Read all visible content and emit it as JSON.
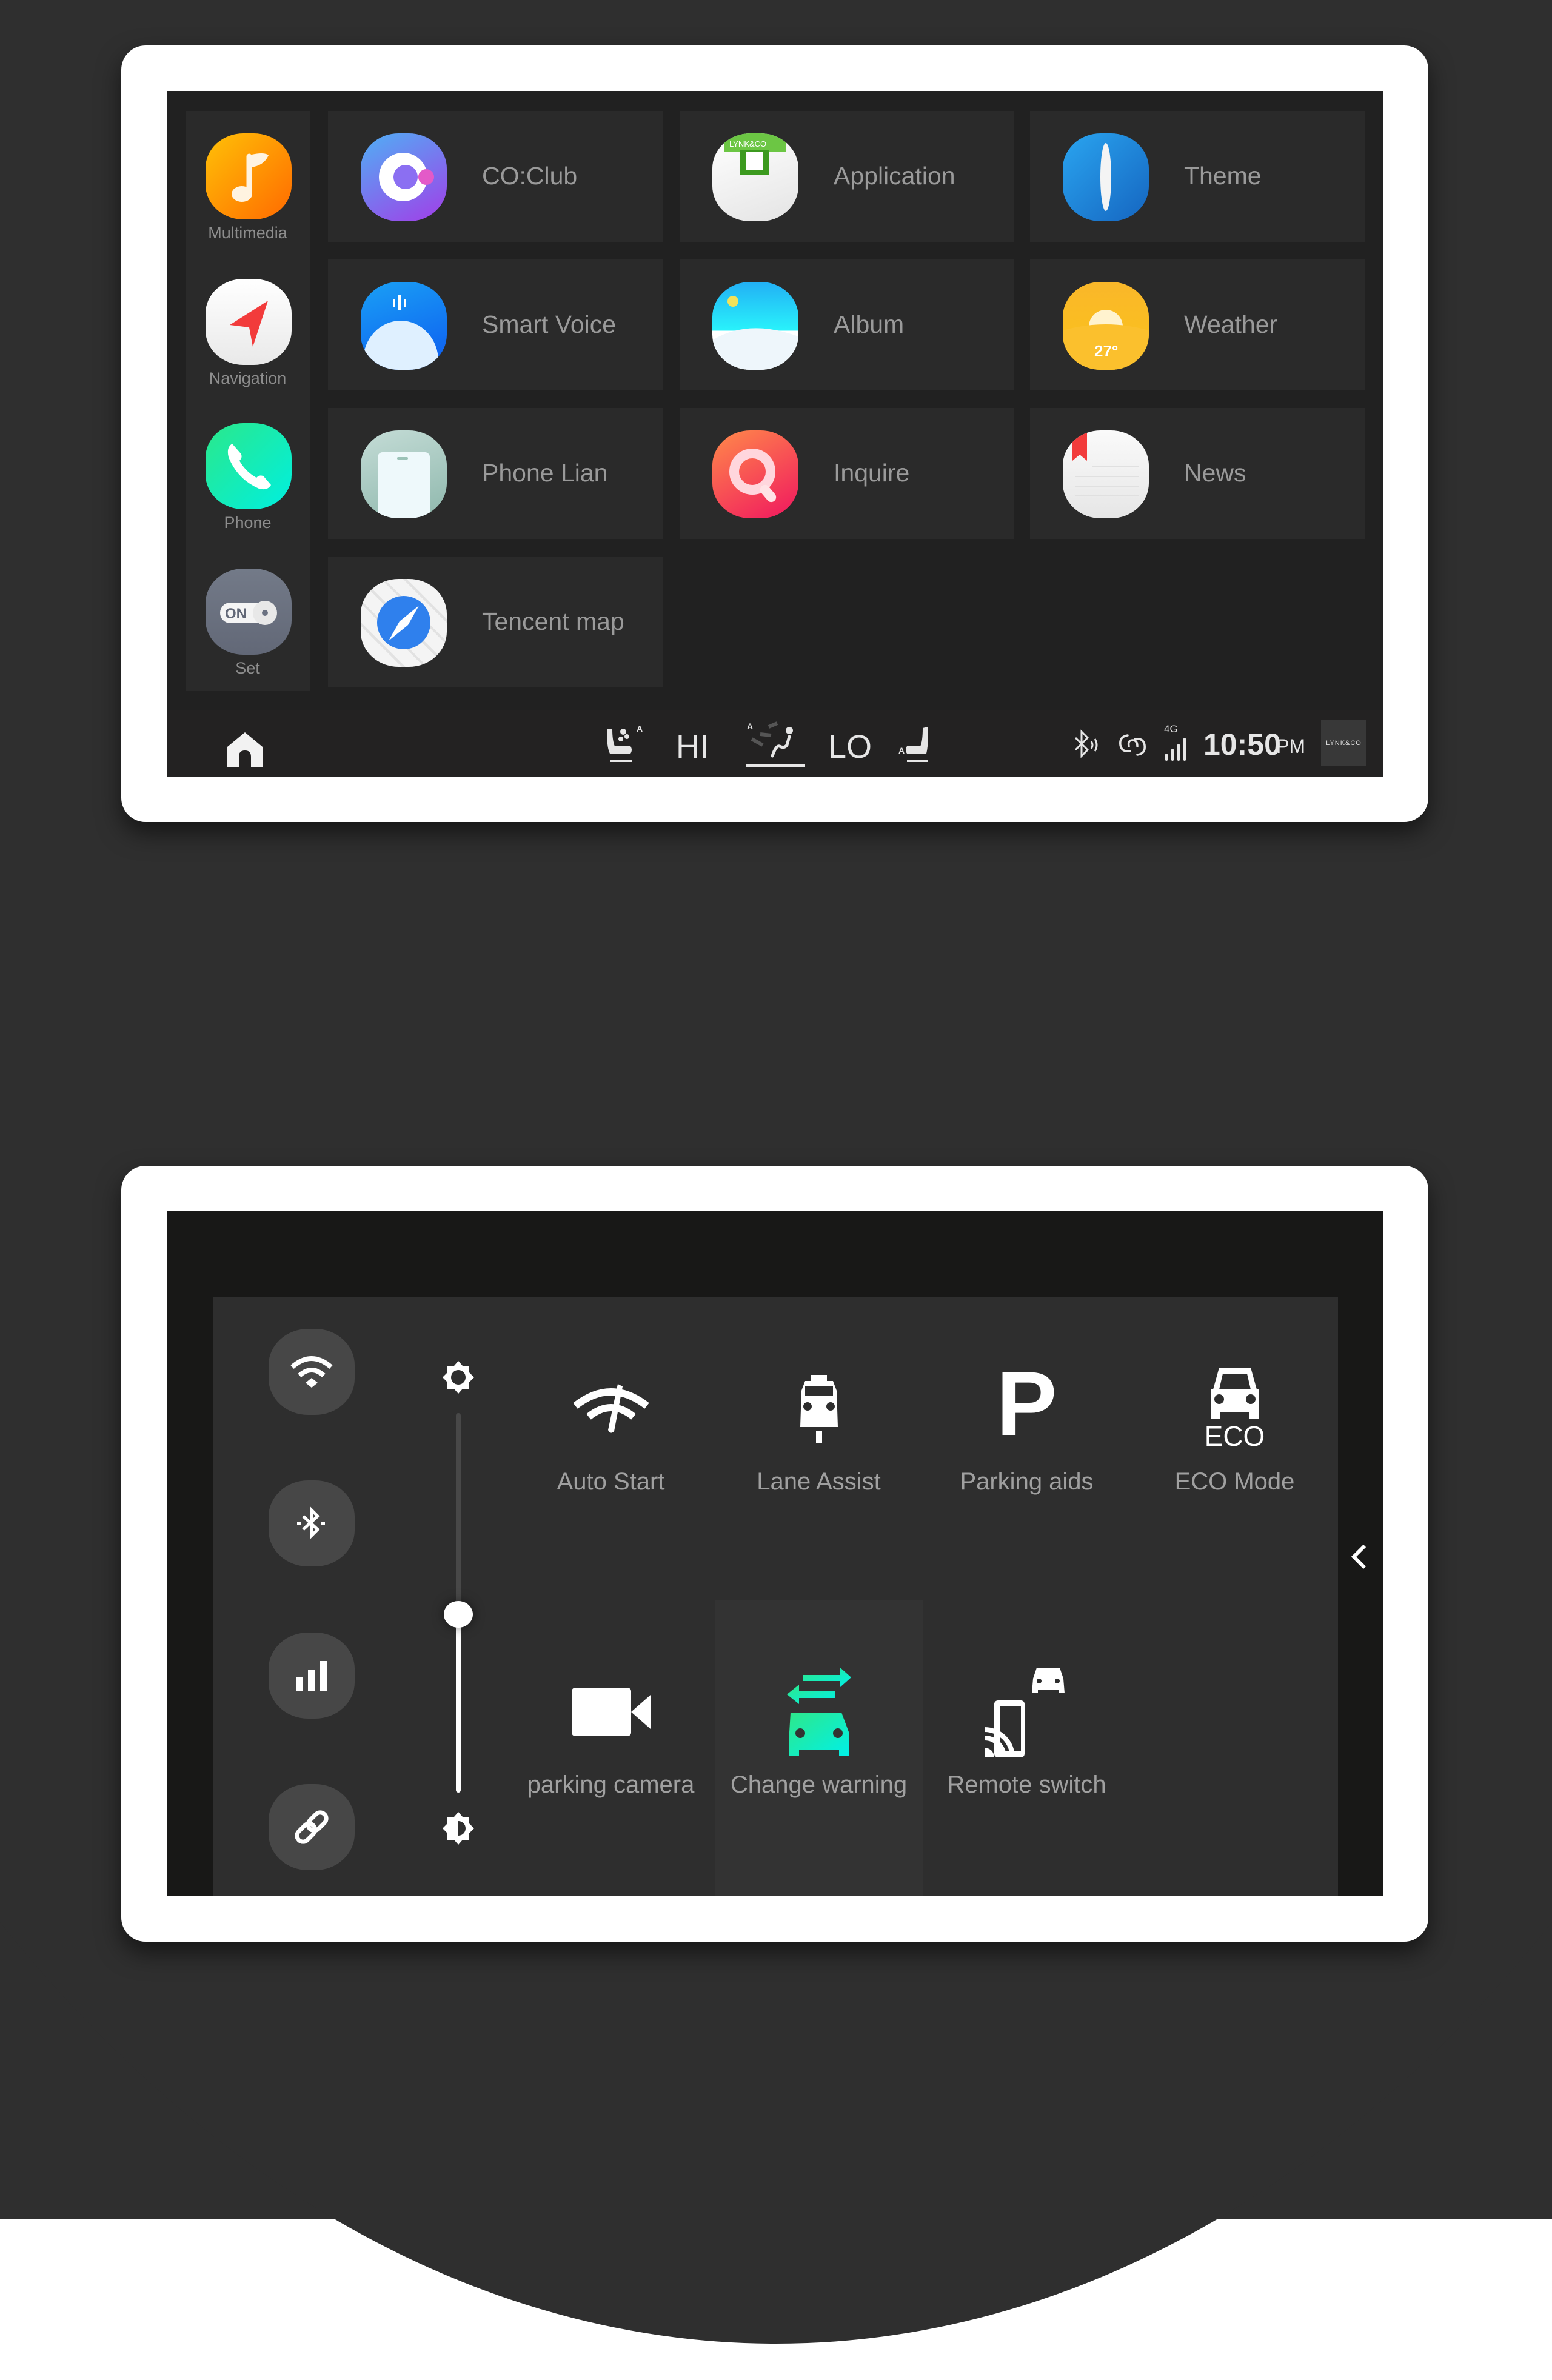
{
  "home_screen": {
    "sidebar": [
      {
        "label": "Multimedia",
        "icon": "music-note-icon",
        "color": "#ff8a00"
      },
      {
        "label": "Navigation",
        "icon": "navigation-arrow-icon",
        "color": "#f2f2f2"
      },
      {
        "label": "Phone",
        "icon": "phone-icon",
        "color": "#1de9b6"
      },
      {
        "label": "Set",
        "icon": "settings-toggle-icon",
        "color": "#6b7282"
      }
    ],
    "apps": [
      {
        "label": "CO:Club",
        "icon": "coclub-icon",
        "color": "#7b6cf0"
      },
      {
        "label": "Application",
        "icon": "application-store-icon",
        "color": "#5aa92d"
      },
      {
        "label": "Theme",
        "icon": "theme-icon",
        "color": "#1e88e5"
      },
      {
        "label": "Smart Voice",
        "icon": "smart-voice-icon",
        "color": "#1a73e8"
      },
      {
        "label": "Album",
        "icon": "album-icon",
        "color": "#29d3f6"
      },
      {
        "label": "Weather",
        "icon": "weather-icon",
        "color": "#f8b21a",
        "badge": "27°"
      },
      {
        "label": "Phone Lian",
        "icon": "phone-link-icon",
        "color": "#9cc3b8"
      },
      {
        "label": "Inquire",
        "icon": "inquire-search-icon",
        "color": "#f0356a"
      },
      {
        "label": "News",
        "icon": "news-icon",
        "color": "#f3f3f3"
      },
      {
        "label": "Tencent map",
        "icon": "tencent-map-icon",
        "color": "#2f80ed"
      }
    ],
    "status_bar": {
      "fan_level": "HI",
      "temp_level": "LO",
      "seat_auto_label": "A",
      "network": "4G",
      "time": "10:50",
      "ampm": "PM",
      "brand": "LYNK&CO"
    }
  },
  "control_center": {
    "brightness_level": 0.47,
    "quick_toggles": [
      {
        "name": "wifi",
        "icon": "wifi-icon"
      },
      {
        "name": "bluetooth",
        "icon": "bluetooth-icon"
      },
      {
        "name": "cellular",
        "icon": "signal-bars-icon"
      },
      {
        "name": "link",
        "icon": "link-icon"
      }
    ],
    "features": [
      {
        "label": "Auto Start",
        "icon": "auto-start-gauge-icon",
        "active": false
      },
      {
        "label": "Lane Assist",
        "icon": "lane-assist-icon",
        "active": false
      },
      {
        "label": "Parking aids",
        "icon": "parking-p-icon",
        "active": false,
        "glyph": "P"
      },
      {
        "label": "ECO Mode",
        "icon": "eco-car-icon",
        "active": false,
        "glyph": "ECO"
      },
      {
        "label": "parking camera",
        "icon": "video-camera-icon",
        "active": false
      },
      {
        "label": "Change warning",
        "icon": "lane-change-warning-icon",
        "active": true
      },
      {
        "label": "Remote switch",
        "icon": "remote-switch-icon",
        "active": false
      }
    ],
    "accent_color": "#1de9b6"
  }
}
